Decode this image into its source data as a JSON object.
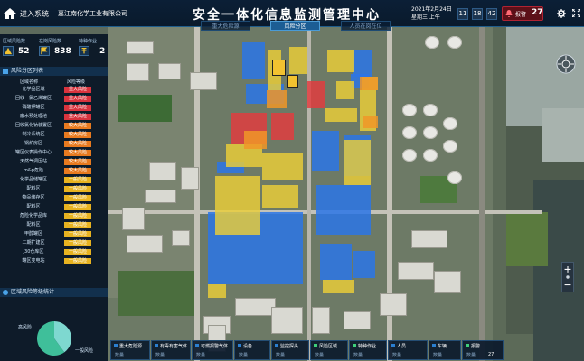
{
  "header": {
    "system_name": "进入系统",
    "company": "嘉江南化学工业有限公司",
    "title": "安全一体化信息监测管理中心",
    "date": "2021年2月24日",
    "weekday": "星期三 上午",
    "clock": {
      "h": "11",
      "m": "18",
      "s": "42"
    },
    "alarm_label": "报警",
    "alarm_count": "27"
  },
  "tabs": [
    {
      "label": "重大危险源",
      "active": false
    },
    {
      "label": "风险分区",
      "active": true
    },
    {
      "label": "人员在岗在位",
      "active": false
    }
  ],
  "stats": [
    {
      "title": "区域风险数",
      "value": "52"
    },
    {
      "title": "在岗风险数",
      "value": "838"
    },
    {
      "title": "特种作业",
      "value": "2"
    }
  ],
  "risk_section": {
    "title": "风险分区列表",
    "col_area": "区域名称",
    "col_level": "风险等级",
    "rows": [
      {
        "name": "化学品区域",
        "level": "重大风险",
        "color": "#d9343e"
      },
      {
        "name": "回收一氯乙烯罐区",
        "level": "重大风险",
        "color": "#d9343e"
      },
      {
        "name": "硝酸钾罐区",
        "level": "重大风险",
        "color": "#d9343e"
      },
      {
        "name": "废水预处理池",
        "level": "重大风险",
        "color": "#d9343e"
      },
      {
        "name": "回收氯化钠装置区",
        "level": "较大风险",
        "color": "#e87a1f"
      },
      {
        "name": "制冷系统区",
        "level": "较大风险",
        "color": "#e87a1f"
      },
      {
        "name": "锅炉房区",
        "level": "较大风险",
        "color": "#e87a1f"
      },
      {
        "name": "罐区仪表操作中心",
        "level": "较大风险",
        "color": "#e87a1f"
      },
      {
        "name": "天然气调压站",
        "level": "较大风险",
        "color": "#e87a1f"
      },
      {
        "name": "m&p危险",
        "level": "较大风险",
        "color": "#e87a1f"
      },
      {
        "name": "化学品储罐区",
        "level": "一般风险",
        "color": "#e8b320"
      },
      {
        "name": "配料区",
        "level": "一般风险",
        "color": "#e8b320"
      },
      {
        "name": "物品储存区",
        "level": "一般风险",
        "color": "#e8b320"
      },
      {
        "name": "配料区",
        "level": "一般风险",
        "color": "#e8b320"
      },
      {
        "name": "危险化学品库",
        "level": "一般风险",
        "color": "#e8b320"
      },
      {
        "name": "配料区",
        "level": "一般风险",
        "color": "#e8b320"
      },
      {
        "name": "甲醇罐区",
        "level": "一般风险",
        "color": "#e8b320"
      },
      {
        "name": "二期扩建区",
        "level": "一般风险",
        "color": "#e8b320"
      },
      {
        "name": "J30仓库区",
        "level": "一般风险",
        "color": "#e8b320"
      },
      {
        "name": "罐区变电站",
        "level": "一般风险",
        "color": "#e8b320"
      }
    ]
  },
  "pie_section": {
    "title": "区域风险等级统计",
    "label_major": "高风险",
    "label_general": "一般风险"
  },
  "pie_data": {
    "slices": [
      {
        "name": "高风险",
        "value": 40,
        "color": "#7ed8d0"
      },
      {
        "name": "一般风险",
        "value": 60,
        "color": "#3fbf9a"
      }
    ]
  },
  "bottom_cards": [
    {
      "title": "重大危险源",
      "sub": "数量",
      "color": "#2b7fd0"
    },
    {
      "title": "有毒有害气体",
      "sub": "数量",
      "color": "#2b7fd0"
    },
    {
      "title": "可燃报警气体",
      "sub": "数量",
      "color": "#2b7fd0"
    },
    {
      "title": "设备",
      "sub": "数量",
      "color": "#2b7fd0"
    },
    {
      "title": "监控探头",
      "sub": "数量",
      "color": "#2b7fd0"
    },
    {
      "title": "风险区域",
      "sub": "数量",
      "color": "#3ecf7a"
    },
    {
      "title": "特种作业",
      "sub": "数量",
      "color": "#3ecf7a"
    },
    {
      "title": "人员",
      "sub": "数量",
      "color": "#2b7fd0"
    },
    {
      "title": "车辆",
      "sub": "数量",
      "color": "#2b7fd0"
    },
    {
      "title": "报警",
      "sub": "数量",
      "value": "27",
      "color": "#3ecf7a"
    }
  ]
}
